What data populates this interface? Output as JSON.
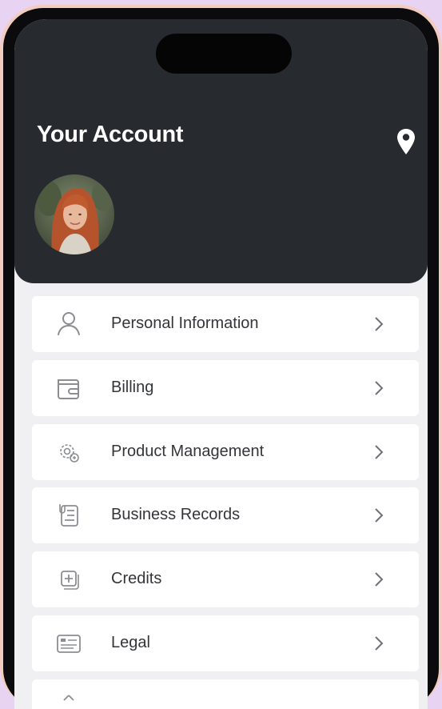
{
  "header": {
    "title": "Your Account",
    "location_icon": "map-pin-icon",
    "avatar": "profile-photo"
  },
  "menu": {
    "items": [
      {
        "label": "Personal Information",
        "icon": "person-icon"
      },
      {
        "label": "Billing",
        "icon": "wallet-icon"
      },
      {
        "label": "Product Management",
        "icon": "gear-icon"
      },
      {
        "label": "Business Records",
        "icon": "records-icon"
      },
      {
        "label": "Credits",
        "icon": "credits-icon"
      },
      {
        "label": "Legal",
        "icon": "document-icon"
      },
      {
        "label": "",
        "icon": "partial-icon"
      }
    ]
  },
  "colors": {
    "header_bg": "#272a2f",
    "screen_bg": "#f0f0f2",
    "frame": "#f2cdbf",
    "backdrop": "#e9d3f3",
    "text": "#333539",
    "icon": "#8b8d92"
  }
}
